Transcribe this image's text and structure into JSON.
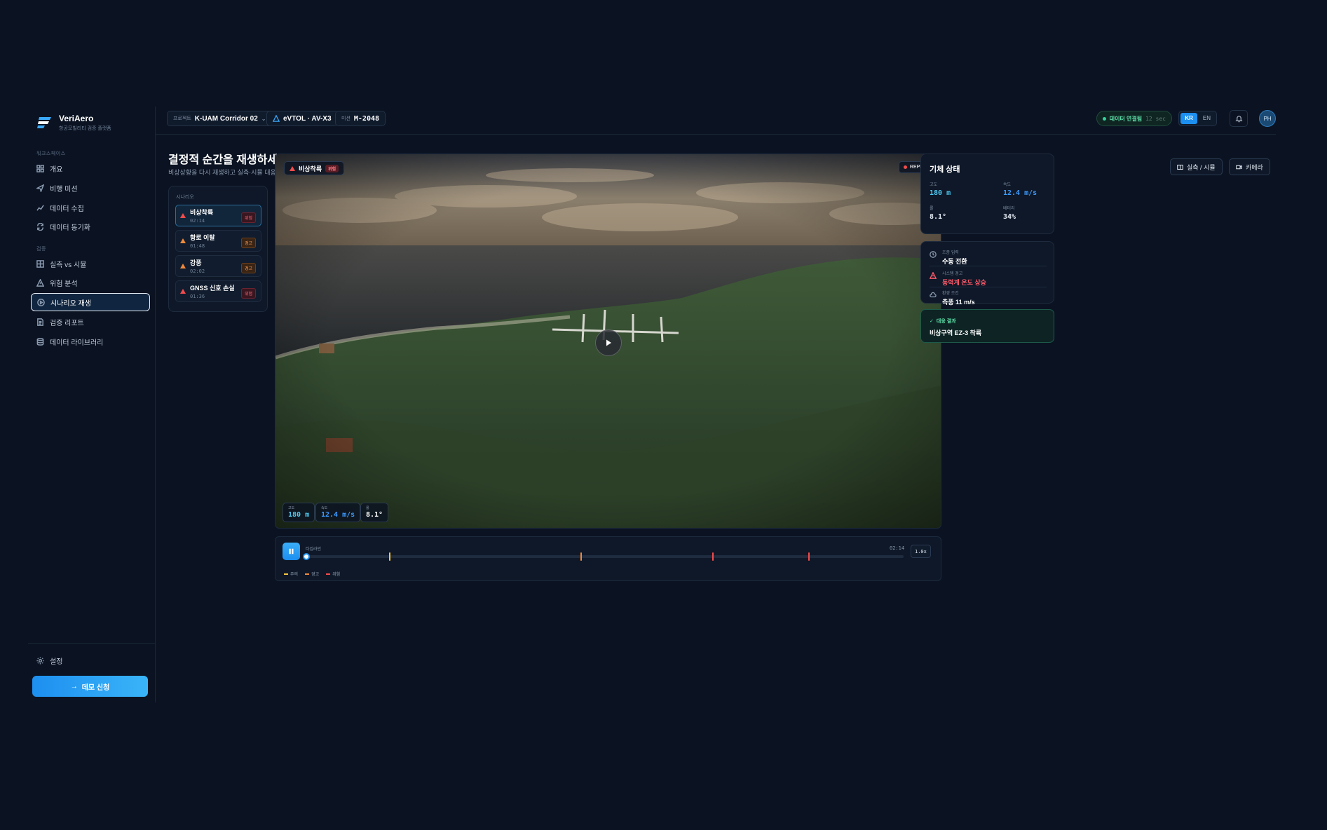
{
  "brand": {
    "name": "VeriAero",
    "subtitle": "항공모빌리티 검증 플랫폼"
  },
  "sidebar": {
    "section_workspace": "워크스페이스",
    "section_verify": "검증",
    "items": [
      {
        "label": "개요",
        "icon": "grid-icon"
      },
      {
        "label": "비행 미션",
        "icon": "send-icon"
      },
      {
        "label": "데이터 수집",
        "icon": "chart-line-icon"
      },
      {
        "label": "데이터 동기화",
        "icon": "sync-icon"
      },
      {
        "label": "실측 vs 시뮬",
        "icon": "compare-grid-icon"
      },
      {
        "label": "위험 분석",
        "icon": "warning-icon"
      },
      {
        "label": "시나리오 재생",
        "icon": "play-circle-icon",
        "active": true
      },
      {
        "label": "검증 리포트",
        "icon": "document-icon"
      },
      {
        "label": "데이터 라이브러리",
        "icon": "database-icon"
      }
    ],
    "settings_label": "설정",
    "demo_button": "데모 신청"
  },
  "header": {
    "project_label": "프로젝트",
    "project_value": "K-UAM Corridor 02",
    "aircraft_value": "eVTOL · AV-X3",
    "mission_label": "미션",
    "mission_value": "M-2048",
    "status_text": "데이터 연결됨",
    "status_latency": "12 sec",
    "lang_kr": "KR",
    "lang_en": "EN",
    "avatar_initials": "PH"
  },
  "page": {
    "title": "결정적 순간을 재생하세요",
    "subtitle": "비상상황을 다시 재생하고 실측·시뮬 대응을 비교합니다.",
    "btn_compare": "실측 / 시뮬",
    "btn_camera": "카메라"
  },
  "scenarios": {
    "header": "시나리오",
    "items": [
      {
        "name": "비상착륙",
        "time": "02:14",
        "badge": "위험",
        "level": "danger"
      },
      {
        "name": "항로 이탈",
        "time": "01:48",
        "badge": "경고",
        "level": "warn"
      },
      {
        "name": "강풍",
        "time": "02:02",
        "badge": "경고",
        "level": "warn"
      },
      {
        "name": "GNSS 신호 손실",
        "time": "01:36",
        "badge": "위험",
        "level": "danger"
      }
    ]
  },
  "viewport": {
    "tag": "비상착륙",
    "tag_badge": "위험",
    "replay": "REPLAY",
    "hud": [
      {
        "label": "고도",
        "value": "180 m",
        "color": "#4cc9f0"
      },
      {
        "label": "속도",
        "value": "12.4 m/s",
        "color": "#3d9bff"
      },
      {
        "label": "롤",
        "value": "8.1°",
        "color": "#ffffff"
      }
    ]
  },
  "timeline": {
    "label": "타임라인",
    "time": "02:14",
    "speed": "1.0x",
    "progress": 0,
    "events": [
      {
        "pos": 0.14,
        "level": "caution"
      },
      {
        "pos": 0.46,
        "level": "warn"
      },
      {
        "pos": 0.68,
        "level": "danger"
      },
      {
        "pos": 0.84,
        "level": "danger"
      }
    ],
    "legend": [
      {
        "label": "주의",
        "color": "#f5c542"
      },
      {
        "label": "경고",
        "color": "#f08a3c"
      },
      {
        "label": "위험",
        "color": "#f24c4c"
      }
    ]
  },
  "aircraft_state": {
    "title": "기체 상태",
    "stats": [
      {
        "label": "고도",
        "value": "180 m",
        "color": "#4cc9f0"
      },
      {
        "label": "속도",
        "value": "12.4 m/s",
        "color": "#3d9bff"
      },
      {
        "label": "롤",
        "value": "8.1°",
        "color": "#ffffff"
      },
      {
        "label": "배터리",
        "value": "34%",
        "color": "#ffffff"
      }
    ]
  },
  "events_panel": [
    {
      "label": "조종 입력",
      "value": "수동 전환",
      "icon": "clock-icon",
      "color": "#ffffff"
    },
    {
      "label": "시스템 경고",
      "value": "동력계 온도 상승",
      "icon": "warning-icon",
      "color": "#ff5a6a"
    },
    {
      "label": "환경 조건",
      "value": "측풍 11 m/s",
      "icon": "cloud-icon",
      "color": "#ffffff"
    }
  ],
  "result": {
    "label": "대응 결과",
    "value": "비상구역 EZ-3 착륙"
  },
  "colors": {
    "accent": "#1c8ff0",
    "danger": "#f24c4c",
    "warn": "#f08a3c",
    "ok": "#34d399"
  }
}
